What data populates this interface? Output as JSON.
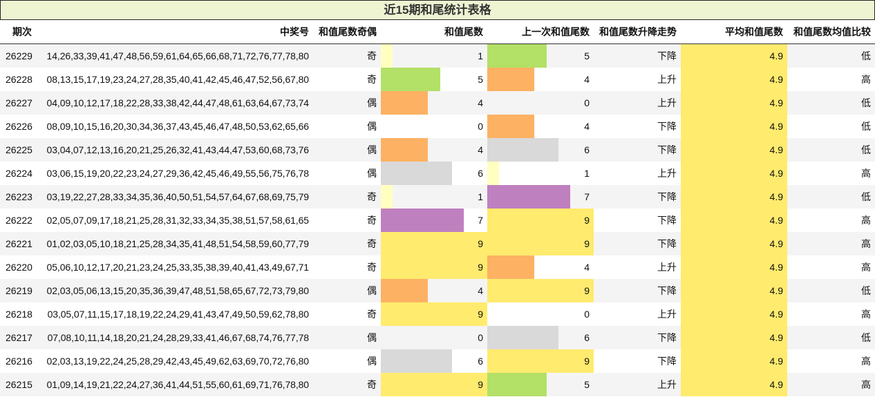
{
  "title": "近15期和尾统计表格",
  "headers": [
    "期次",
    "中奖号",
    "和值尾数奇偶",
    "和值尾数",
    "上一次和值尾数",
    "和值尾数升降走势",
    "平均和值尾数",
    "和值尾数均值比较"
  ],
  "bar_max": 9,
  "bar_colors": {
    "1": "#ffffc0",
    "4": "#fdb163",
    "5": "#b3e066",
    "6": "#d9d9d9",
    "7": "#bf80bf",
    "9": "#ffeb6e"
  },
  "rows": [
    {
      "issue": "26229",
      "numbers": "14,26,33,39,41,47,48,56,59,61,64,65,66,68,71,72,76,77,78,80",
      "parity": "奇",
      "tail": 1,
      "prev_tail": 5,
      "trend": "下降",
      "avg": "4.9",
      "compare": "低"
    },
    {
      "issue": "26228",
      "numbers": "08,13,15,17,19,23,24,27,28,35,40,41,42,45,46,47,52,56,67,80",
      "parity": "奇",
      "tail": 5,
      "prev_tail": 4,
      "trend": "上升",
      "avg": "4.9",
      "compare": "高"
    },
    {
      "issue": "26227",
      "numbers": "04,09,10,12,17,18,22,28,33,38,42,44,47,48,61,63,64,67,73,74",
      "parity": "偶",
      "tail": 4,
      "prev_tail": 0,
      "trend": "上升",
      "avg": "4.9",
      "compare": "低"
    },
    {
      "issue": "26226",
      "numbers": "08,09,10,15,16,20,30,34,36,37,43,45,46,47,48,50,53,62,65,66",
      "parity": "偶",
      "tail": 0,
      "prev_tail": 4,
      "trend": "下降",
      "avg": "4.9",
      "compare": "低"
    },
    {
      "issue": "26225",
      "numbers": "03,04,07,12,13,16,20,21,25,26,32,41,43,44,47,53,60,68,73,76",
      "parity": "偶",
      "tail": 4,
      "prev_tail": 6,
      "trend": "下降",
      "avg": "4.9",
      "compare": "低"
    },
    {
      "issue": "26224",
      "numbers": "03,06,15,19,20,22,23,24,27,29,36,42,45,46,49,55,56,75,76,78",
      "parity": "偶",
      "tail": 6,
      "prev_tail": 1,
      "trend": "上升",
      "avg": "4.9",
      "compare": "高"
    },
    {
      "issue": "26223",
      "numbers": "03,19,22,27,28,33,34,35,36,40,50,51,54,57,64,67,68,69,75,79",
      "parity": "奇",
      "tail": 1,
      "prev_tail": 7,
      "trend": "下降",
      "avg": "4.9",
      "compare": "低"
    },
    {
      "issue": "26222",
      "numbers": "02,05,07,09,17,18,21,25,28,31,32,33,34,35,38,51,57,58,61,65",
      "parity": "奇",
      "tail": 7,
      "prev_tail": 9,
      "trend": "下降",
      "avg": "4.9",
      "compare": "高"
    },
    {
      "issue": "26221",
      "numbers": "01,02,03,05,10,18,21,25,28,34,35,41,48,51,54,58,59,60,77,79",
      "parity": "奇",
      "tail": 9,
      "prev_tail": 9,
      "trend": "下降",
      "avg": "4.9",
      "compare": "高"
    },
    {
      "issue": "26220",
      "numbers": "05,06,10,12,17,20,21,23,24,25,33,35,38,39,40,41,43,49,67,71",
      "parity": "奇",
      "tail": 9,
      "prev_tail": 4,
      "trend": "上升",
      "avg": "4.9",
      "compare": "高"
    },
    {
      "issue": "26219",
      "numbers": "02,03,05,06,13,15,20,35,36,39,47,48,51,58,65,67,72,73,79,80",
      "parity": "偶",
      "tail": 4,
      "prev_tail": 9,
      "trend": "下降",
      "avg": "4.9",
      "compare": "低"
    },
    {
      "issue": "26218",
      "numbers": "03,05,07,11,15,17,18,19,22,24,29,41,43,47,49,50,59,62,78,80",
      "parity": "奇",
      "tail": 9,
      "prev_tail": 0,
      "trend": "上升",
      "avg": "4.9",
      "compare": "高"
    },
    {
      "issue": "26217",
      "numbers": "07,08,10,11,14,18,20,21,24,28,29,33,41,46,67,68,74,76,77,78",
      "parity": "偶",
      "tail": 0,
      "prev_tail": 6,
      "trend": "下降",
      "avg": "4.9",
      "compare": "低"
    },
    {
      "issue": "26216",
      "numbers": "02,03,13,19,22,24,25,28,29,42,43,45,49,62,63,69,70,72,76,80",
      "parity": "偶",
      "tail": 6,
      "prev_tail": 9,
      "trend": "下降",
      "avg": "4.9",
      "compare": "高"
    },
    {
      "issue": "26215",
      "numbers": "01,09,14,19,21,22,24,27,36,41,44,51,55,60,61,69,71,76,78,80",
      "parity": "奇",
      "tail": 9,
      "prev_tail": 5,
      "trend": "上升",
      "avg": "4.9",
      "compare": "高"
    }
  ]
}
